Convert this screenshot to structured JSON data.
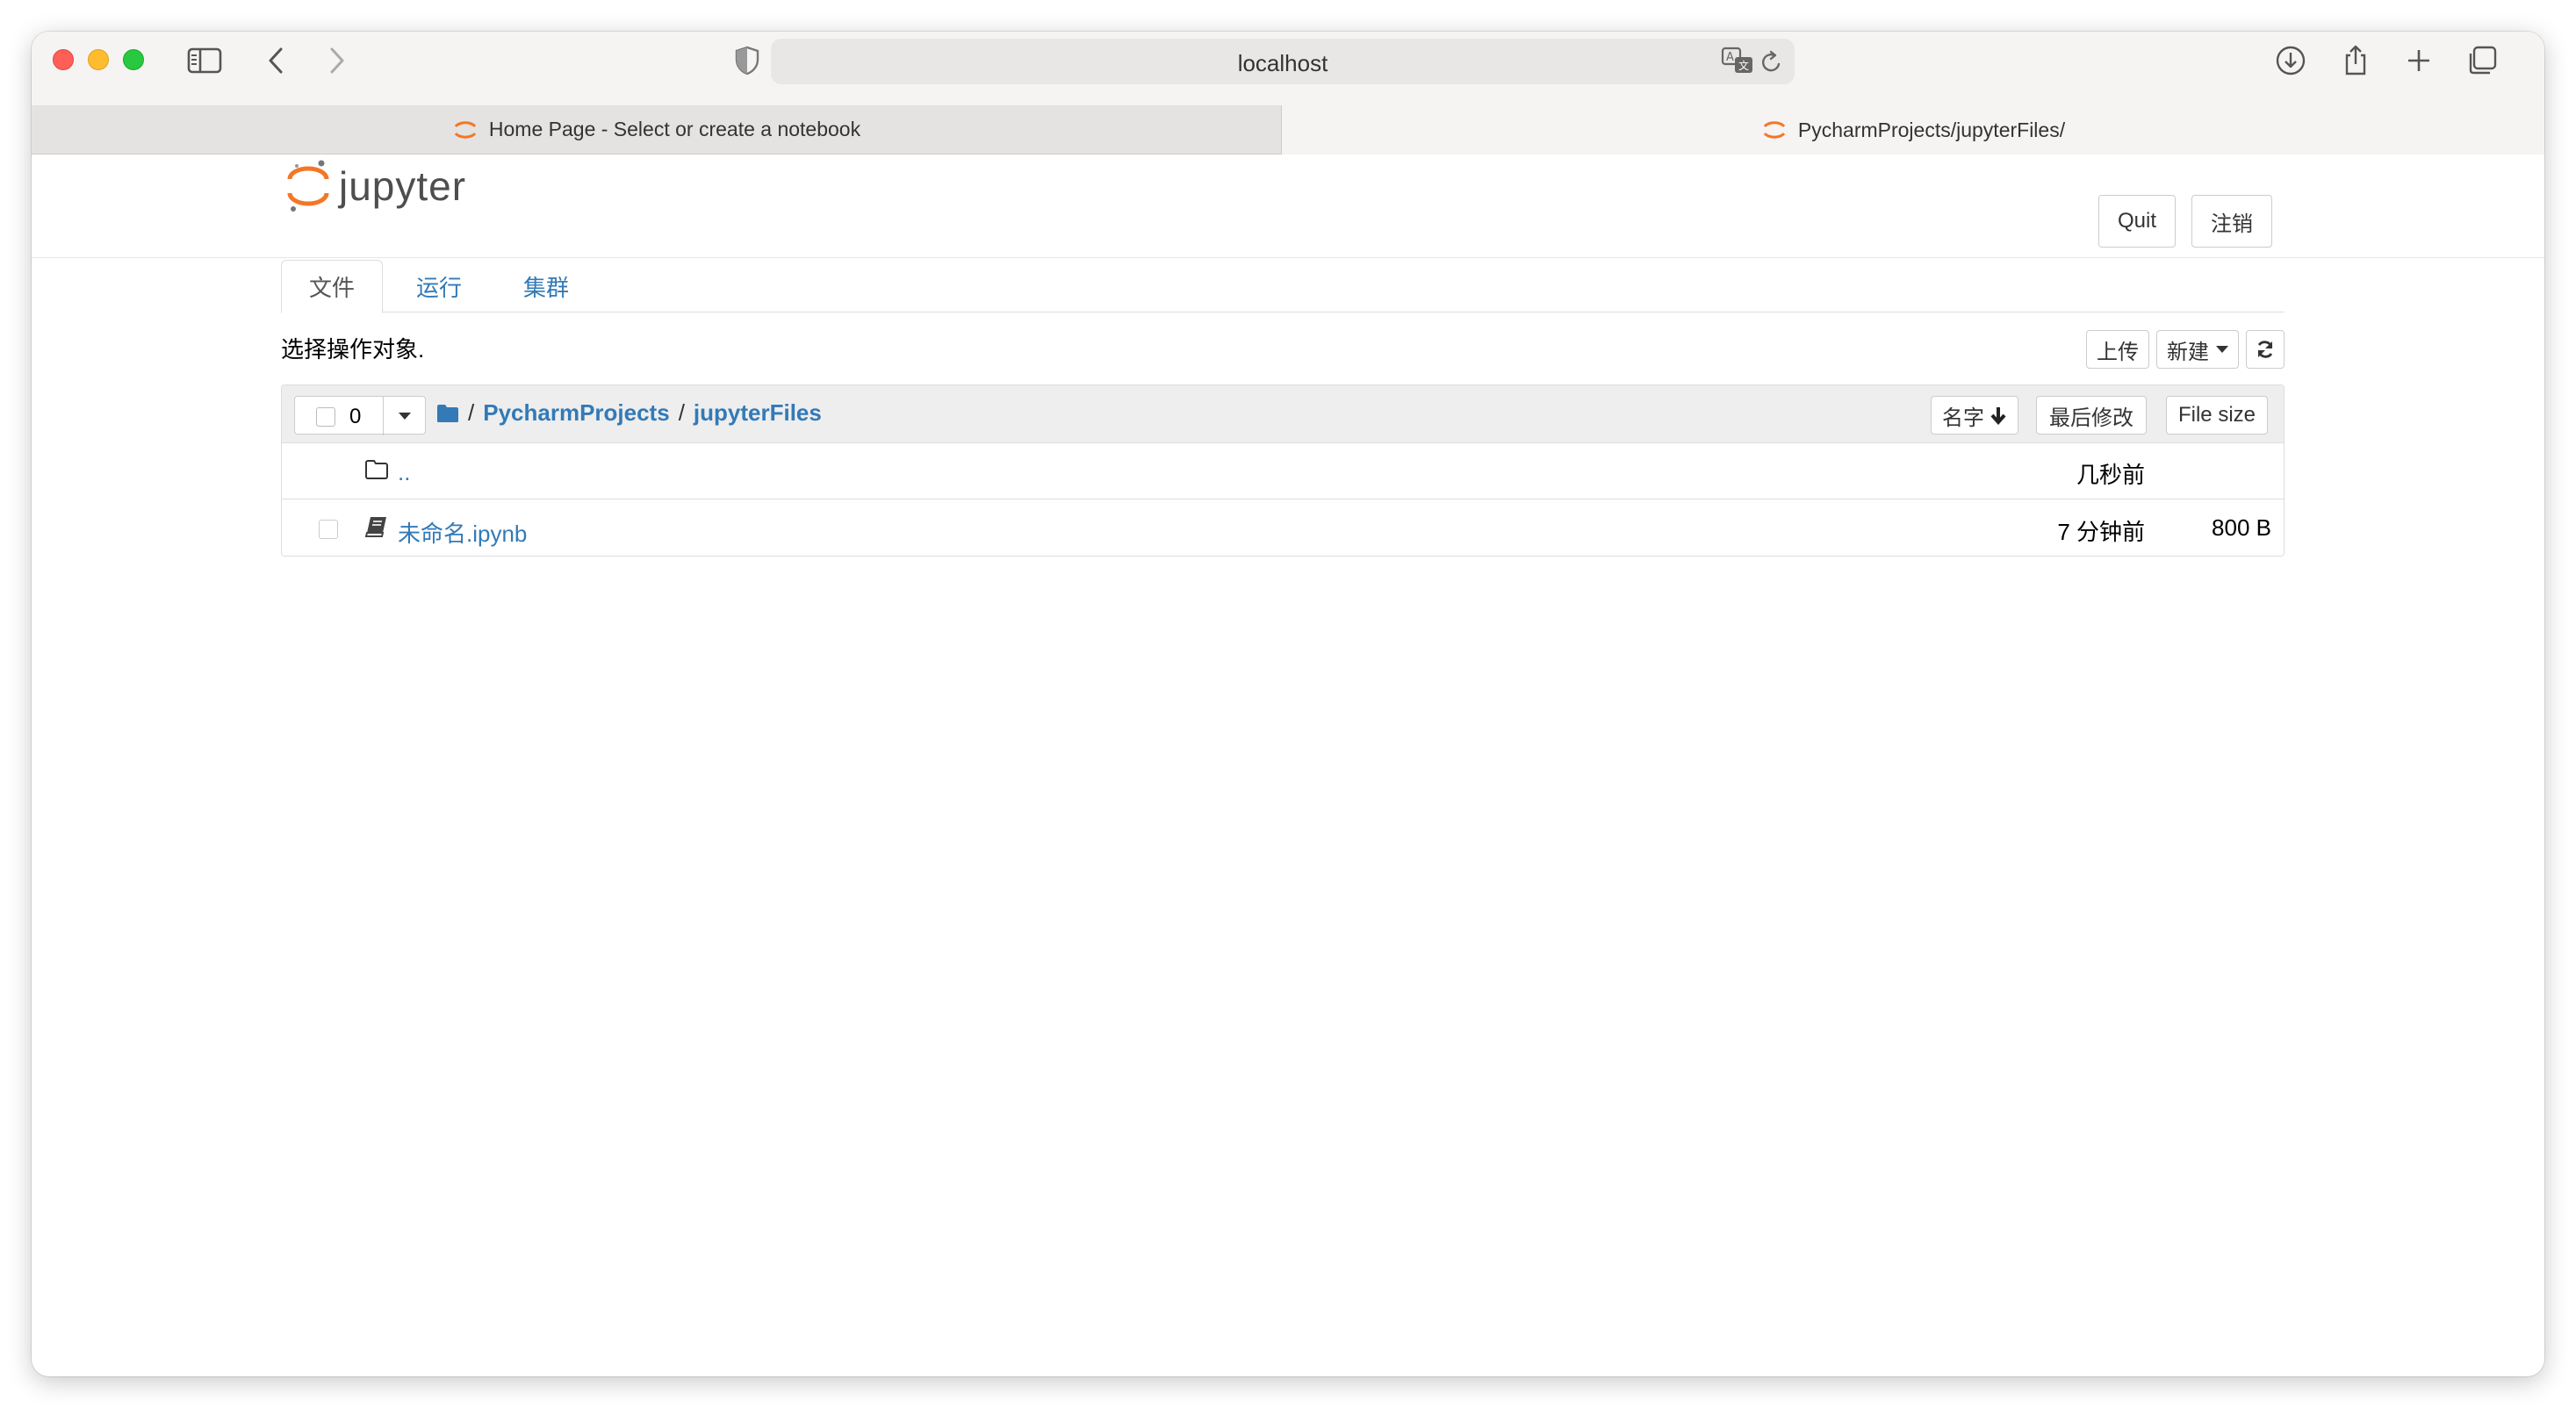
{
  "browser": {
    "address": "localhost",
    "tabs": [
      {
        "title": "Home Page - Select or create a notebook",
        "active": false
      },
      {
        "title": "PycharmProjects/jupyterFiles/",
        "active": true
      }
    ]
  },
  "header": {
    "logo_text": "jupyter",
    "quit_label": "Quit",
    "logout_label": "注销"
  },
  "nav_tabs": [
    {
      "label": "文件",
      "active": true
    },
    {
      "label": "运行",
      "active": false
    },
    {
      "label": "集群",
      "active": false
    }
  ],
  "toolbar": {
    "instruction": "选择操作对象.",
    "upload_label": "上传",
    "new_label": "新建"
  },
  "file_list": {
    "selected_count": "0",
    "breadcrumb": {
      "separator": "/",
      "items": [
        "PycharmProjects",
        "jupyterFiles"
      ]
    },
    "sort_name_label": "名字",
    "sort_modified_label": "最后修改",
    "sort_size_label": "File size",
    "rows": [
      {
        "name": "..",
        "modified": "几秒前",
        "size": "",
        "type": "folder"
      },
      {
        "name": "未命名.ipynb",
        "modified": "7 分钟前",
        "size": "800 B",
        "type": "notebook"
      }
    ]
  },
  "colors": {
    "link": "#337ab7",
    "jupyter_orange": "#f37726",
    "close": "#ff5f57",
    "minimize": "#febc2e",
    "zoom": "#28c840"
  }
}
